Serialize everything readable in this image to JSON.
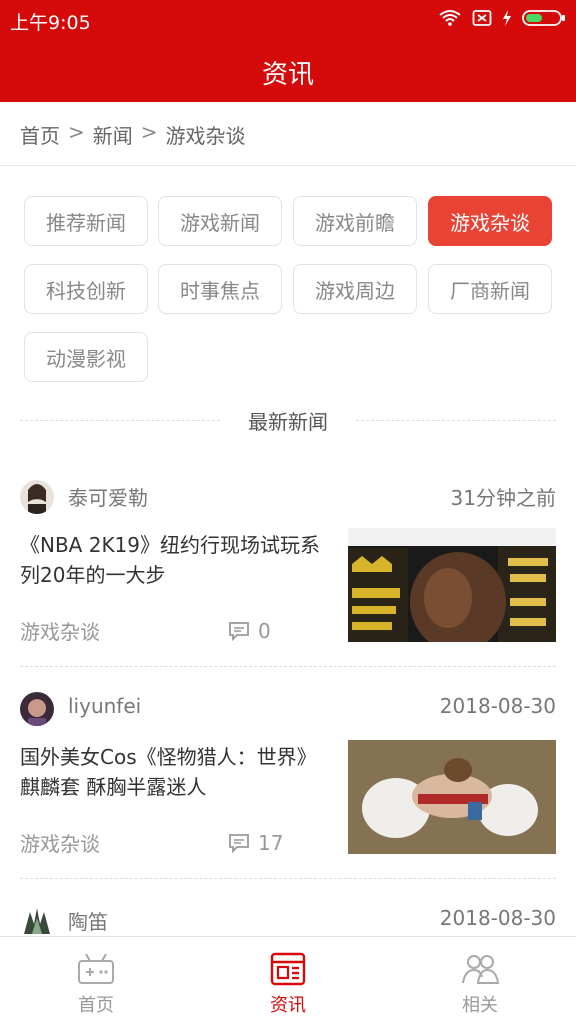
{
  "status_bar": {
    "time": "上午9:05"
  },
  "header": {
    "title": "资讯"
  },
  "breadcrumb": {
    "items": [
      "首页",
      "新闻",
      "游戏杂谈"
    ],
    "separator": ">"
  },
  "categories": {
    "items": [
      "推荐新闻",
      "游戏新闻",
      "游戏前瞻",
      "游戏杂谈",
      "科技创新",
      "时事焦点",
      "游戏周边",
      "厂商新闻",
      "动漫影视"
    ],
    "active_index": 3
  },
  "section": {
    "title": "最新新闻"
  },
  "news": [
    {
      "author": "泰可爱勒",
      "time": "31分钟之前",
      "title": "《NBA 2K19》纽约行现场试玩系列20年的一大步",
      "category": "游戏杂谈",
      "comments": "0"
    },
    {
      "author": "liyunfei",
      "time": "2018-08-30",
      "title": "国外美女Cos《怪物猎人：世界》麒麟套 酥胸半露迷人",
      "category": "游戏杂谈",
      "comments": "17"
    },
    {
      "author": "陶笛",
      "time": "2018-08-30"
    }
  ],
  "tabs": [
    {
      "label": "首页",
      "icon": "gamepad-icon"
    },
    {
      "label": "资讯",
      "icon": "news-icon"
    },
    {
      "label": "相关",
      "icon": "people-icon"
    }
  ],
  "colors": {
    "brand_red": "#d50a0a",
    "active_tag": "#e84335"
  }
}
